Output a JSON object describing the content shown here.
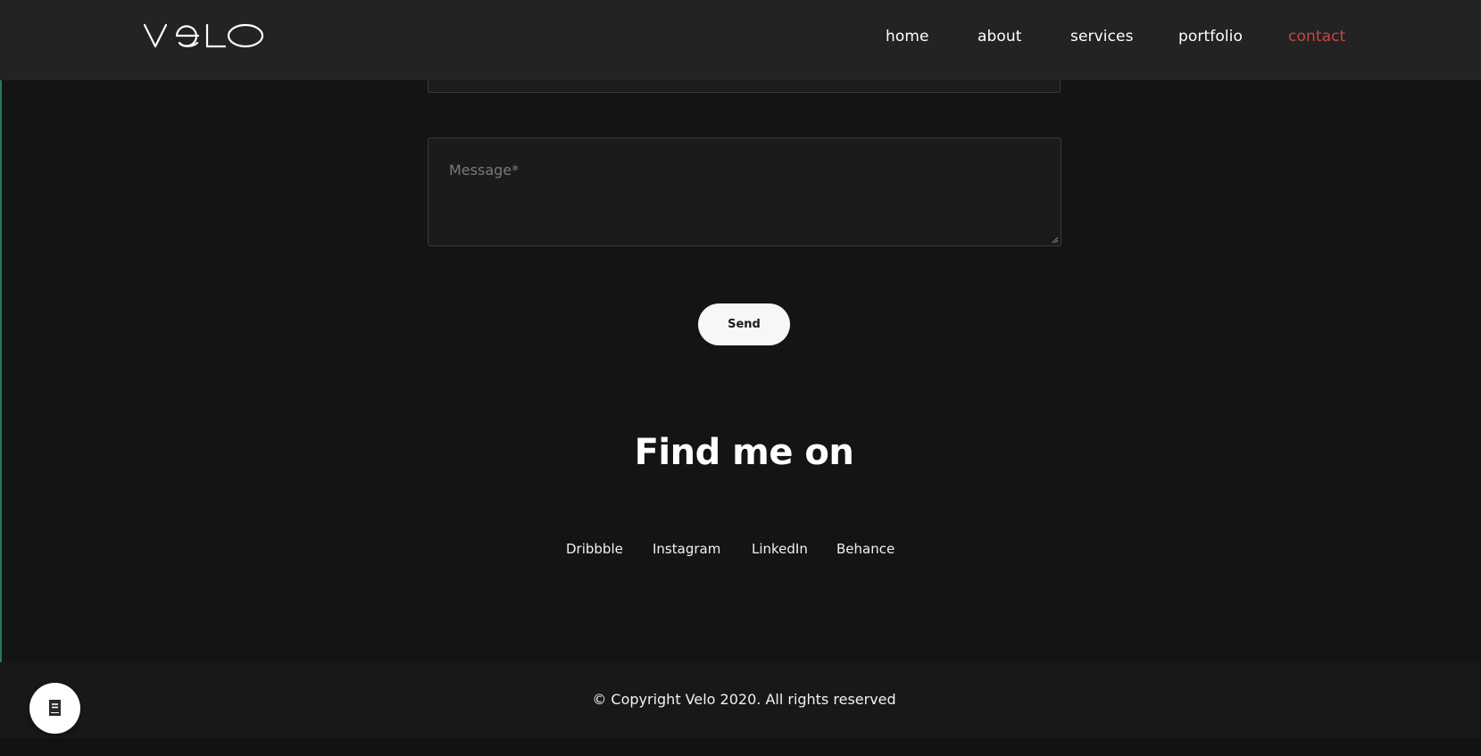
{
  "header": {
    "logo_text": "velo",
    "nav": [
      {
        "label": "home",
        "active": false
      },
      {
        "label": "about",
        "active": false
      },
      {
        "label": "services",
        "active": false
      },
      {
        "label": "portfolio",
        "active": false
      },
      {
        "label": "contact",
        "active": true
      }
    ]
  },
  "form": {
    "message_placeholder": "Message*",
    "send_label": "Send"
  },
  "social": {
    "title": "Find me on",
    "links": [
      "Dribbble",
      "Instagram",
      "LinkedIn",
      "Behance"
    ]
  },
  "footer": {
    "copyright": "© Copyright Velo 2020. All rights reserved"
  },
  "fab": {
    "icon": "book-icon"
  },
  "colors": {
    "background": "#141414",
    "header": "#232323",
    "accent": "#c8473b",
    "button": "#f7f7f8"
  }
}
